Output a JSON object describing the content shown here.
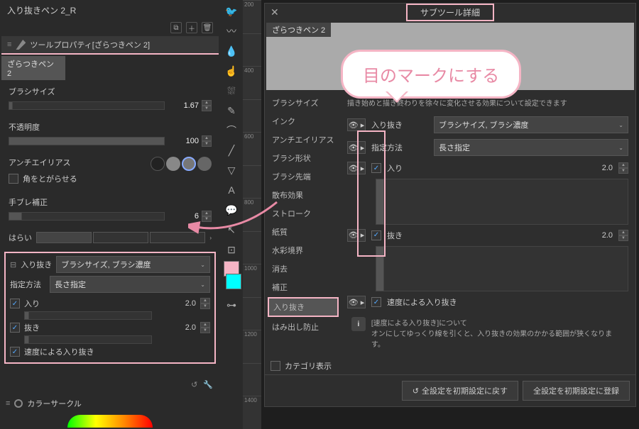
{
  "left": {
    "file_name": "入り抜きペン 2_R",
    "header": "ツールプロパティ[ざらつきペン 2]",
    "sub_title": "ざらつきペン 2",
    "brush_size_label": "ブラシサイズ",
    "brush_size_val": "1.67",
    "opacity_label": "不透明度",
    "opacity_val": "100",
    "antialias_label": "アンチエイリアス",
    "round_corners": "角をとがらせる",
    "stabilize_label": "手ブレ補正",
    "stabilize_val": "6",
    "harai_label": "はらい",
    "taper_label": "入り抜き",
    "taper_dropdown": "ブラシサイズ, ブラシ濃度",
    "method_label": "指定方法",
    "method_dropdown": "長さ指定",
    "in_label": "入り",
    "in_val": "2.0",
    "out_label": "抜き",
    "out_val": "2.0",
    "speed_taper": "速度による入り抜き",
    "color_circle": "カラーサークル"
  },
  "ruler_ticks": [
    "200",
    "",
    "400",
    "",
    "600",
    "",
    "800",
    "",
    "1000",
    "",
    "1200",
    "",
    "1400"
  ],
  "dialog": {
    "title": "サブツール詳細",
    "preview_tab": "ざらつきペン 2",
    "description": "描き始めと描き終わりを徐々に変化させる効果について設定できます",
    "categories": [
      "ブラシサイズ",
      "インク",
      "アンチエイリアス",
      "ブラシ形状",
      "ブラシ先端",
      "散布効果",
      "ストローク",
      "紙質",
      "水彩境界",
      "消去",
      "補正",
      "入り抜き",
      "はみ出し防止"
    ],
    "taper_label": "入り抜き",
    "taper_dropdown": "ブラシサイズ, ブラシ濃度",
    "method_label": "指定方法",
    "method_dropdown": "長さ指定",
    "in_label": "入り",
    "in_val": "2.0",
    "out_label": "抜き",
    "out_val": "2.0",
    "speed_taper": "速度による入り抜き",
    "info_title": "[速度による入り抜き]について",
    "info_body": "オンにしてゆっくり線を引くと、入り抜きの効果のかかる範囲が狭くなります。",
    "show_category": "カテゴリ表示",
    "reset_btn": "全設定を初期設定に戻す",
    "register_btn": "全設定を初期設定に登録"
  },
  "bubble_text": "目のマークにする"
}
